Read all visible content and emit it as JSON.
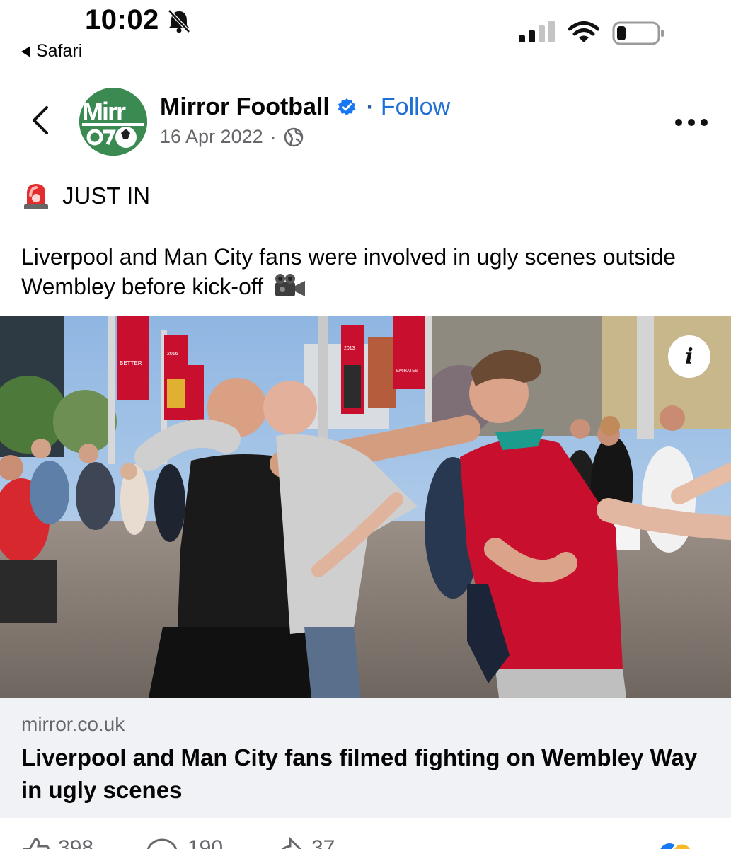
{
  "status_bar": {
    "time": "10:02",
    "back_app_label": "Safari",
    "icons": [
      "bell-slash-icon",
      "cellular-signal-icon",
      "wifi-icon",
      "battery-icon"
    ]
  },
  "post": {
    "page_name": "Mirror Football",
    "follow_label": "Follow",
    "separator": "·",
    "date": "16 Apr 2022",
    "date_separator": "·",
    "avatar_text": "Mirror",
    "headline_emoji": "siren-icon",
    "headline": "JUST IN",
    "body": "Liverpool and Man City fans were involved in ugly scenes outside Wembley before kick-off",
    "body_emoji": "movie-camera-icon"
  },
  "photo": {
    "info_label": "i",
    "banner_text": "EMIRATES",
    "sign_text": "BETTER",
    "years": [
      "2016",
      "2013"
    ]
  },
  "link_preview": {
    "domain": "mirror.co.uk",
    "title": "Liverpool and Man City fans filmed fighting on Wembley Way in ugly scenes"
  },
  "actions": {
    "like_count": "398",
    "comment_count": "190",
    "share_count": "37"
  },
  "colors": {
    "follow": "#1f6fd6",
    "verified": "#1877f2",
    "meta_gray": "#65676b",
    "link_card_bg": "#f0f2f5",
    "avatar_green": "#3a8a52"
  }
}
